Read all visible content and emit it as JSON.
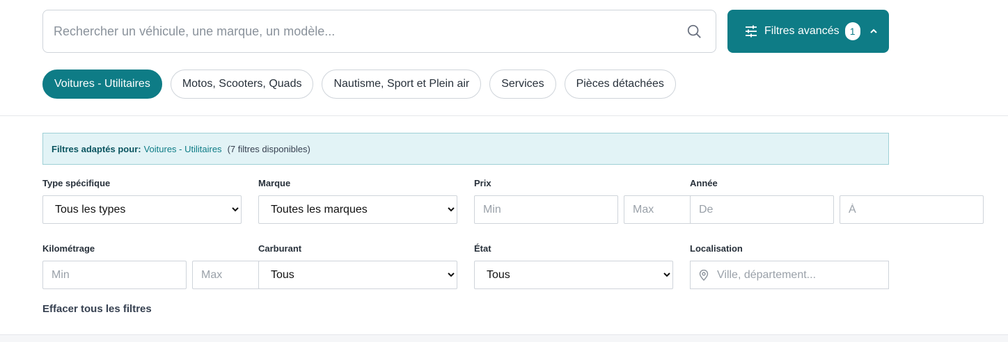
{
  "search": {
    "placeholder": "Rechercher un véhicule, une marque, un modèle...",
    "icon": "search-icon"
  },
  "advanced": {
    "label": "Filtres avancés",
    "count": "1",
    "accent": "#0e7c86"
  },
  "tabs": [
    {
      "label": "Voitures - Utilitaires",
      "active": true
    },
    {
      "label": "Motos, Scooters, Quads",
      "active": false
    },
    {
      "label": "Nautisme, Sport et Plein air",
      "active": false
    },
    {
      "label": "Services",
      "active": false
    },
    {
      "label": "Pièces détachées",
      "active": false
    }
  ],
  "info": {
    "prefix": "Filtres adaptés pour:",
    "category": "Voitures - Utilitaires",
    "count": "(7 filtres disponibles)"
  },
  "filters": {
    "type": {
      "label": "Type spécifique",
      "value": "Tous les types"
    },
    "brand": {
      "label": "Marque",
      "value": "Toutes les marques"
    },
    "price": {
      "label": "Prix",
      "min_placeholder": "Min",
      "max_placeholder": "Max"
    },
    "year": {
      "label": "Année",
      "from_placeholder": "De",
      "to_placeholder": "À"
    },
    "mileage": {
      "label": "Kilométrage",
      "min_placeholder": "Min",
      "max_placeholder": "Max"
    },
    "fuel": {
      "label": "Carburant",
      "value": "Tous"
    },
    "condition": {
      "label": "État",
      "value": "Tous"
    },
    "location": {
      "label": "Localisation",
      "placeholder": "Ville, département..."
    }
  },
  "clear_label": "Effacer tous les filtres"
}
